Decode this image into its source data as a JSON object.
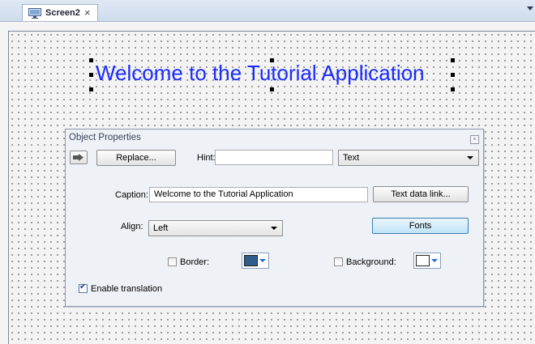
{
  "tab": {
    "label": "Screen2",
    "close": "×"
  },
  "canvas": {
    "welcome_text": "Welcome to the Tutorial Application"
  },
  "panel": {
    "title": "Object Properties",
    "close_glyph": "×",
    "replace_label": "Replace...",
    "hint_label": "Hint:",
    "hint_value": "",
    "type_value": "Text",
    "caption_label": "Caption:",
    "caption_value": "Welcome to the Tutorial Application",
    "text_data_link_label": "Text data link...",
    "align_label": "Align:",
    "align_value": "Left",
    "fonts_label": "Fonts",
    "border_label": "Border:",
    "border_checked": false,
    "border_color": "#2f5d8a",
    "background_label": "Background:",
    "background_checked": false,
    "background_color": "#ffffff",
    "enable_translation_label": "Enable translation",
    "enable_translation_checked": true
  },
  "colors": {
    "accent": "#1a2bff",
    "panel_bg": "#eef1f6"
  }
}
